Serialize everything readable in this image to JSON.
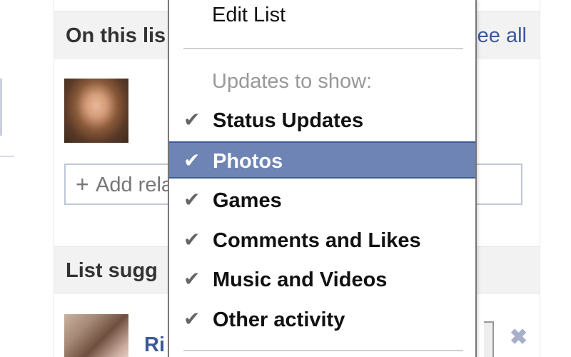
{
  "list_panel": {
    "on_this_list_title": "On this lis",
    "see_all_label": "ee all",
    "add_button": {
      "plus": "+",
      "label": "Add rela"
    },
    "list_suggestions_title": "List sugg",
    "suggestion_name": "Ri",
    "dismiss_symbol": "✖"
  },
  "dropdown_menu": {
    "edit_list_label": "Edit List",
    "updates_heading": "Updates to show:",
    "check_glyph": "✔",
    "items": [
      {
        "label": "Status Updates",
        "checked": true,
        "highlighted": false
      },
      {
        "label": "Photos",
        "checked": true,
        "highlighted": true
      },
      {
        "label": "Games",
        "checked": true,
        "highlighted": false
      },
      {
        "label": "Comments and Likes",
        "checked": true,
        "highlighted": false
      },
      {
        "label": "Music and Videos",
        "checked": true,
        "highlighted": false
      },
      {
        "label": "Other activity",
        "checked": true,
        "highlighted": false
      }
    ]
  },
  "colors": {
    "highlight_bg": "#6d84b4",
    "link": "#3b5998",
    "header_bg": "#f2f2f2",
    "muted_text": "#999999"
  }
}
